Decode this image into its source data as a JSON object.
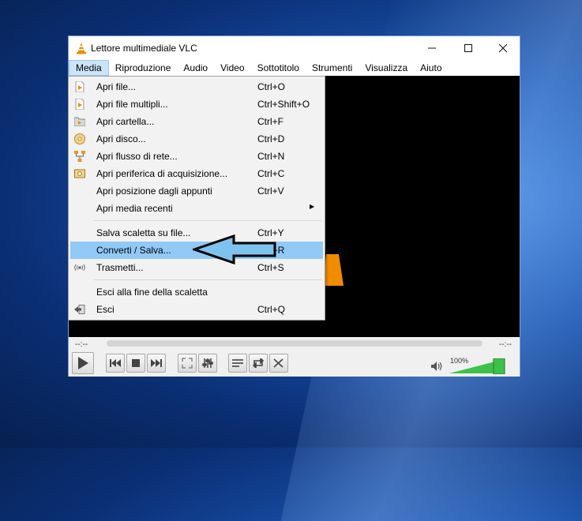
{
  "window": {
    "title": "Lettore multimediale VLC",
    "minimize_icon": "minimize-icon",
    "maximize_icon": "maximize-icon",
    "close_icon": "close-icon"
  },
  "menubar": {
    "items": [
      "Media",
      "Riproduzione",
      "Audio",
      "Video",
      "Sottotitolo",
      "Strumenti",
      "Visualizza",
      "Aiuto"
    ],
    "active": "Media"
  },
  "media_menu": {
    "items": [
      {
        "label": "Apri file...",
        "shortcut": "Ctrl+O",
        "icon": "file-icon"
      },
      {
        "label": "Apri file multipli...",
        "shortcut": "Ctrl+Shift+O",
        "icon": "files-icon"
      },
      {
        "label": "Apri cartella...",
        "shortcut": "Ctrl+F",
        "icon": "folder-icon"
      },
      {
        "label": "Apri disco...",
        "shortcut": "Ctrl+D",
        "icon": "disc-icon"
      },
      {
        "label": "Apri flusso di rete...",
        "shortcut": "Ctrl+N",
        "icon": "network-icon"
      },
      {
        "label": "Apri periferica di acquisizione...",
        "shortcut": "Ctrl+C",
        "icon": "capture-device-icon"
      },
      {
        "label": "Apri posizione dagli appunti",
        "shortcut": "Ctrl+V",
        "icon": ""
      },
      {
        "label": "Apri media recenti",
        "shortcut": "",
        "icon": "",
        "submenu": true
      },
      {
        "label": "Salva scaletta su file...",
        "shortcut": "Ctrl+Y",
        "icon": ""
      },
      {
        "label": "Converti / Salva...",
        "shortcut": "Ctrl+R",
        "icon": "",
        "highlighted": true
      },
      {
        "label": "Trasmetti...",
        "shortcut": "Ctrl+S",
        "icon": "stream-icon"
      },
      {
        "label": "Esci alla fine della scaletta",
        "shortcut": "",
        "icon": ""
      },
      {
        "label": "Esci",
        "shortcut": "Ctrl+Q",
        "icon": "exit-icon"
      }
    ]
  },
  "player": {
    "elapsed": "--:--",
    "remaining": "--:--",
    "volume_label": "100%",
    "volume_level": 1.0
  },
  "colors": {
    "menu_highlight": "#91c9f7",
    "volume_green": "#3cc24a",
    "vlc_orange": "#f08c00"
  }
}
